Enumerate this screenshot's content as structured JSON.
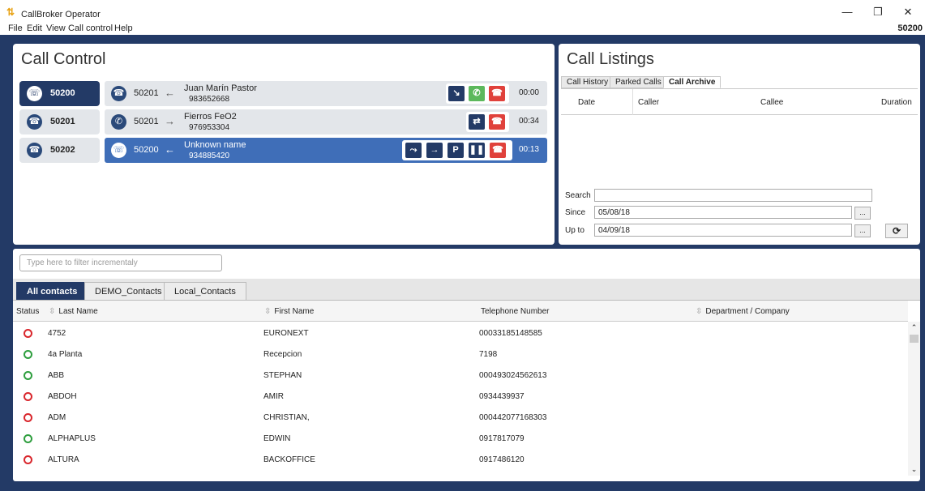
{
  "window": {
    "app_icon": "callbroker-logo-icon",
    "title": "CallBroker Operator",
    "minimize": "—",
    "restore": "❐",
    "close": "✕"
  },
  "menu": {
    "items": [
      "File",
      "Edit",
      "View",
      "Call control",
      "Help"
    ],
    "extension": "50200"
  },
  "call_control": {
    "title": "Call Control",
    "extensions": [
      {
        "label": "50200",
        "icon": "phone-ringing-icon",
        "active": true
      },
      {
        "label": "50201",
        "icon": "phone-hold-icon",
        "active": false
      },
      {
        "label": "50202",
        "icon": "phone-hangup-icon",
        "active": false
      }
    ],
    "calls": [
      {
        "ext": "50201",
        "dir": "←",
        "name": "Juan Marín Pastor",
        "number": "983652668",
        "time": "00:00",
        "active": false
      },
      {
        "ext": "50201",
        "dir": "→",
        "name": "Fierros FeO2",
        "number": "976953304",
        "time": "00:34",
        "active": false
      },
      {
        "ext": "50200",
        "dir": "←",
        "name": "Unknown name",
        "number": "934885420",
        "time": "00:13",
        "active": true
      }
    ]
  },
  "call_listings": {
    "title": "Call Listings",
    "tabs": [
      "Call History",
      "Parked Calls",
      "Call Archive"
    ],
    "active_tab": "Call Archive",
    "columns": [
      "Date",
      "Caller",
      "Callee",
      "Duration"
    ],
    "search_label": "Search",
    "search_value": "",
    "since_label": "Since",
    "since_value": "05/08/18",
    "upto_label": "Up to",
    "upto_value": "04/09/18",
    "dots": "...",
    "refresh": "⟳"
  },
  "contacts": {
    "filter_placeholder": "Type here to filter incrementaly",
    "tabs": [
      "All contacts",
      "DEMO_Contacts",
      "Local_Contacts"
    ],
    "columns": [
      "Status",
      "Last Name",
      "First Name",
      "Telephone Number",
      "Department / Company"
    ],
    "sort_icon": "⇳",
    "rows": [
      {
        "status": "red",
        "last": "4752",
        "first": "EURONEXT",
        "phone": "00033185148585",
        "dept": ""
      },
      {
        "status": "green",
        "last": "4a Planta",
        "first": "Recepcion",
        "phone": "7198",
        "dept": ""
      },
      {
        "status": "green",
        "last": "ABB",
        "first": "STEPHAN",
        "phone": "000493024562613",
        "dept": ""
      },
      {
        "status": "red",
        "last": "ABDOH",
        "first": "AMIR",
        "phone": "0934439937",
        "dept": ""
      },
      {
        "status": "red",
        "last": "ADM",
        "first": "CHRISTIAN,",
        "phone": "000442077168303",
        "dept": ""
      },
      {
        "status": "green",
        "last": "ALPHAPLUS",
        "first": "EDWIN",
        "phone": "0917817079",
        "dept": ""
      },
      {
        "status": "red",
        "last": "ALTURA",
        "first": "BACKOFFICE",
        "phone": "0917486120",
        "dept": ""
      }
    ],
    "colors": {
      "red": "#d9262c",
      "green": "#2e9e3e"
    }
  }
}
